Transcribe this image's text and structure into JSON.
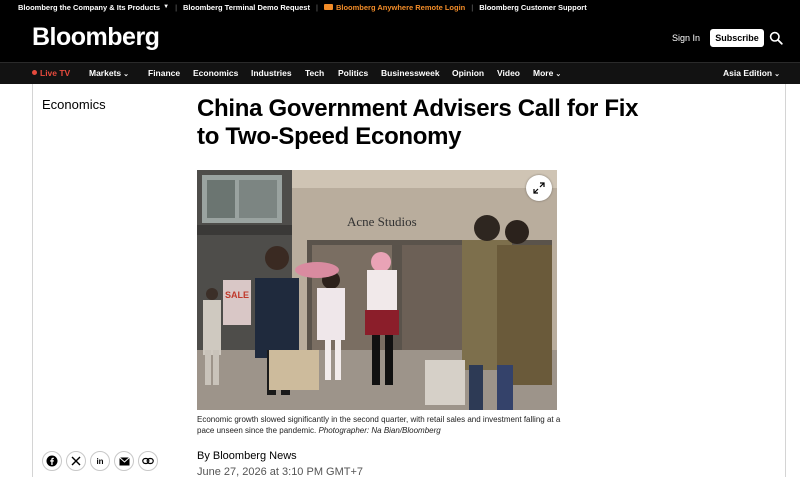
{
  "utility_bar": {
    "company": "Bloomberg the Company & Its Products",
    "terminal": "Bloomberg Terminal Demo Request",
    "anywhere": "Bloomberg Anywhere Remote Login",
    "support": "Bloomberg Customer Support"
  },
  "header": {
    "logo": "Bloomberg",
    "sign_in": "Sign In",
    "subscribe": "Subscribe",
    "search_icon": "search-icon"
  },
  "nav": {
    "live": "Live TV",
    "items": [
      "Markets",
      "Finance",
      "Economics",
      "Industries",
      "Tech",
      "Politics",
      "Businessweek",
      "Opinion",
      "Video",
      "More"
    ],
    "edition": "Asia Edition"
  },
  "article": {
    "section": "Economics",
    "headline": "China Government Advisers Call for Fix to Two-Speed Economy",
    "caption": "Economic growth slowed significantly in the second quarter, with retail sales and investment falling at a pace unseen since the pandemic.",
    "credit": "Photographer: Na Bian/Bloomberg",
    "byline": "By Bloomberg News",
    "date": "June 27, 2026 at 3:10 PM GMT+7",
    "storefront_sign": "Acne Studios",
    "shop_sign": "SALE"
  },
  "share": {
    "icons": [
      "facebook-icon",
      "x-icon",
      "linkedin-icon",
      "email-icon",
      "link-icon"
    ]
  },
  "colors": {
    "accent_orange": "#f28c28",
    "live_red": "#e64a3d",
    "header_bg": "#000000"
  }
}
